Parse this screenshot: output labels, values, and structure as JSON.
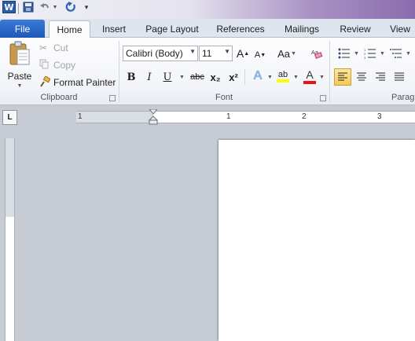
{
  "quick_access": {
    "app_icon": "word-icon",
    "app_letter": "W",
    "items": [
      "save-icon",
      "undo-icon",
      "redo-icon",
      "customize-icon"
    ]
  },
  "tabs": {
    "file": "File",
    "items": [
      "Home",
      "Insert",
      "Page Layout",
      "References",
      "Mailings",
      "Review",
      "View"
    ],
    "active": "Home"
  },
  "clipboard": {
    "paste": "Paste",
    "cut": "Cut",
    "copy": "Copy",
    "format_painter": "Format Painter",
    "label": "Clipboard"
  },
  "font": {
    "name": "Calibri (Body)",
    "size": "11",
    "label": "Font",
    "grow": "A",
    "shrink": "A",
    "change_case": "Aa",
    "bold": "B",
    "italic": "I",
    "underline": "U",
    "strikethrough": "abc",
    "subscript": "x₂",
    "superscript": "x²",
    "text_effects": "A",
    "highlight": "ab",
    "font_color": "A",
    "highlight_color": "#ffff00",
    "font_color_value": "#e81416"
  },
  "paragraph": {
    "label": "Parag"
  },
  "ruler": {
    "numbers": [
      "1",
      "1",
      "2",
      "3"
    ],
    "tab_selector": "L"
  }
}
